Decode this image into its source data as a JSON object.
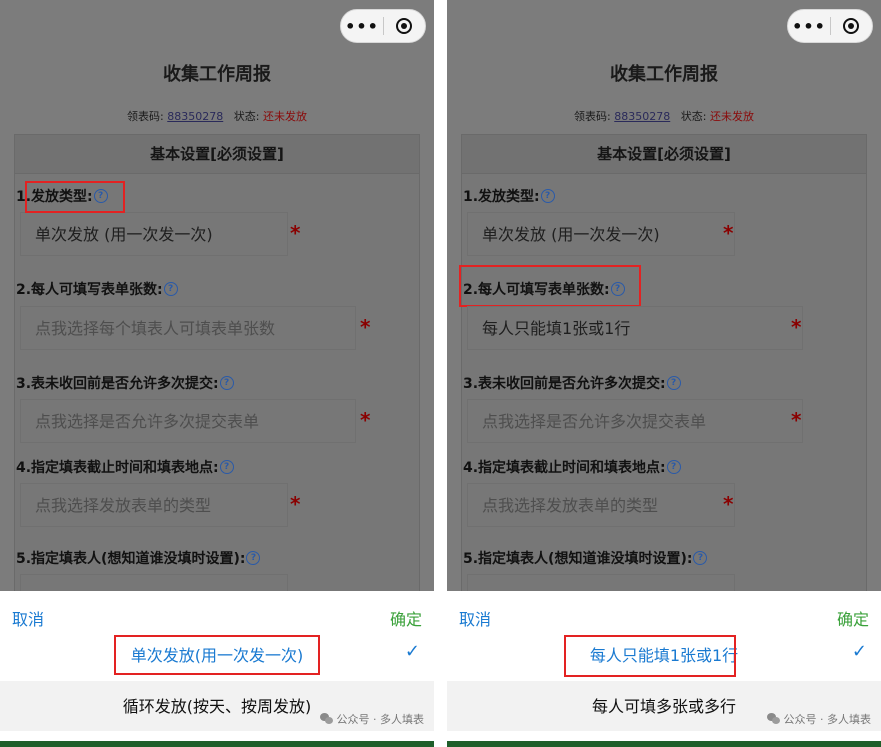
{
  "panels": [
    {
      "capsule": {
        "more_icon": "more-dots-icon",
        "close_icon": "target-close-icon"
      },
      "title": "收集工作周报",
      "subtitle": {
        "code_label": "领表码:",
        "code": "88350278",
        "status_label": "状态:",
        "status": "还未发放"
      },
      "card_header": "基本设置[必须设置]",
      "questions": [
        {
          "label": "1.发放类型:",
          "value": "单次发放 (用一次发一次)"
        },
        {
          "label": "2.每人可填写表单张数:",
          "value": "点我选择每个填表人可填表单张数"
        },
        {
          "label": "3.表未收回前是否允许多次提交:",
          "value": "点我选择是否允许多次提交表单"
        },
        {
          "label": "4.指定填表截止时间和填表地点:",
          "value": "点我选择发放表单的类型"
        },
        {
          "label": "5.指定填表人(想知道谁没填时设置):",
          "value": ""
        }
      ],
      "required_mark": "*",
      "help_mark": "?",
      "sheet": {
        "cancel": "取消",
        "confirm": "确定",
        "selected_option": "单次发放(用一次发一次)",
        "check": "✓",
        "other_option": "循环发放(按天、按周发放)",
        "watermark": "公众号 · 多人填表"
      }
    },
    {
      "capsule": {
        "more_icon": "more-dots-icon",
        "close_icon": "target-close-icon"
      },
      "title": "收集工作周报",
      "subtitle": {
        "code_label": "领表码:",
        "code": "88350278",
        "status_label": "状态:",
        "status": "还未发放"
      },
      "card_header": "基本设置[必须设置]",
      "questions": [
        {
          "label": "1.发放类型:",
          "value": "单次发放 (用一次发一次)"
        },
        {
          "label": "2.每人可填写表单张数:",
          "value": "每人只能填1张或1行"
        },
        {
          "label": "3.表未收回前是否允许多次提交:",
          "value": "点我选择是否允许多次提交表单"
        },
        {
          "label": "4.指定填表截止时间和填表地点:",
          "value": "点我选择发放表单的类型"
        },
        {
          "label": "5.指定填表人(想知道谁没填时设置):",
          "value": ""
        }
      ],
      "required_mark": "*",
      "help_mark": "?",
      "sheet": {
        "cancel": "取消",
        "confirm": "确定",
        "selected_option": "每人只能填1张或1行",
        "check": "✓",
        "other_option": "每人可填多张或多行",
        "watermark": "公众号 · 多人填表"
      }
    }
  ],
  "colors": {
    "accent_blue": "#1a7ad1",
    "confirm_green": "#3aa13a",
    "highlight_red": "#e32222",
    "required_red": "#8a0000"
  }
}
